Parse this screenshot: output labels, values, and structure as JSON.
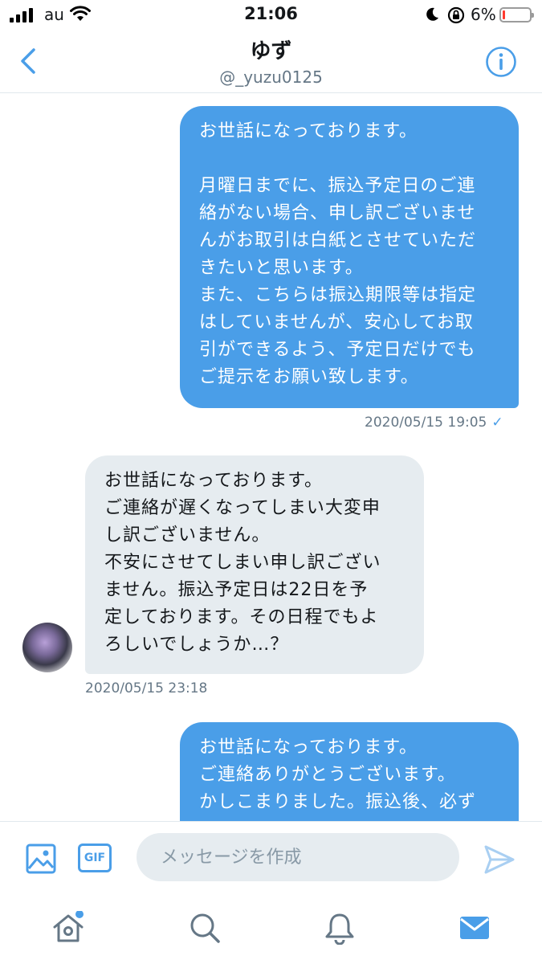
{
  "status_bar": {
    "carrier": "au",
    "time": "21:06",
    "battery": "6%",
    "battery_level": 0.06,
    "icons": [
      "signal-icon",
      "wifi-icon",
      "moon-icon",
      "rotation-lock-icon",
      "battery-icon"
    ]
  },
  "header": {
    "title": "ゆず",
    "handle": "@_yuzu0125",
    "icons": [
      "back-chevron-icon",
      "info-icon"
    ]
  },
  "messages": [
    {
      "direction": "outgoing",
      "text": "お世話になっております。\n\n月曜日までに、振込予定日のご連\n絡がない場合、申し訳ございませ\nんがお取引は白紙とさせていただ\nきたいと思います。\nまた、こちらは振込期限等は指定\nはしていませんが、安心してお取\n引ができるよう、予定日だけでも\nご提示をお願い致します。",
      "timestamp": "2020/05/15 19:05",
      "status": "✓"
    },
    {
      "direction": "incoming",
      "text": "お世話になっております。\nご連絡が遅くなってしまい大変申\nし訳ございません。\n不安にさせてしまい申し訳ござい\nません。振込予定日は22日を予\n定しております。その日程でもよ\nろしいでしょうか…？",
      "timestamp": "2020/05/15 23:18"
    },
    {
      "direction": "outgoing",
      "text": "お世話になっております。\nご連絡ありがとうございます。\nかしこまりました。振込後、必ず"
    }
  ],
  "composer": {
    "placeholder": "メッセージを作成",
    "gif_label": "GIF",
    "icons": [
      "image-icon",
      "send-icon"
    ]
  },
  "tabbar": {
    "icons": [
      "home-icon",
      "search-icon",
      "notifications-icon",
      "messages-icon"
    ],
    "active": "messages-icon",
    "colors": {
      "accent": "#4a9ee8",
      "inactive": "#657786"
    }
  }
}
